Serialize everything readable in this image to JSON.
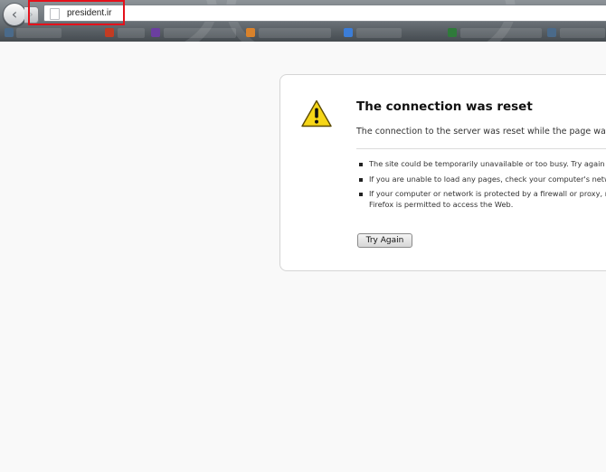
{
  "browser": {
    "address_bar": {
      "url": "president.ir"
    },
    "nav": {
      "back_glyph": "‹",
      "forward_glyph": "›"
    }
  },
  "error_page": {
    "title": "The connection was reset",
    "description": "The connection to the server was reset while the page was",
    "suggestions": [
      {
        "lines": [
          "The site could be temporarily unavailable or too busy. Try again i"
        ]
      },
      {
        "lines": [
          "If you are unable to load any pages, check your computer's netwo"
        ]
      },
      {
        "lines": [
          "If your computer or network is protected by a firewall or proxy, m",
          "Firefox is permitted to access the Web."
        ]
      }
    ],
    "try_again_label": "Try Again"
  },
  "icons": {
    "back": "back-arrow-icon",
    "forward": "forward-arrow-icon",
    "site": "page-icon",
    "warning": "warning-triangle-icon"
  },
  "colors": {
    "annotation": "#e4111b",
    "warning_fill": "#f6d617",
    "card_border": "#d5d5d5"
  }
}
